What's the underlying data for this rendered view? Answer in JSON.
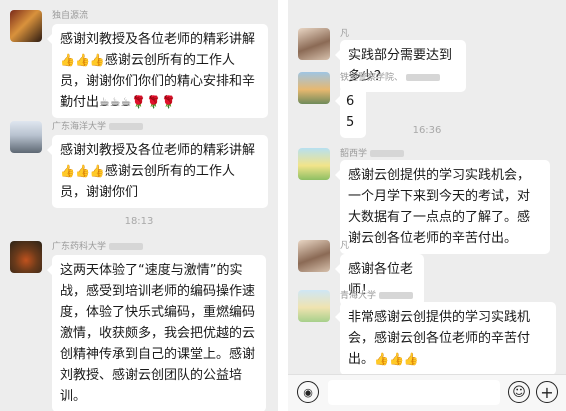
{
  "left": {
    "messages": [
      {
        "sender": "独自源流",
        "text": "感谢刘教授及各位老师的精彩讲解",
        "text2": "感谢云创所有的工作人员，谢谢你们你们的精心安排和辛勤付出"
      },
      {
        "sender": "广东海洋大学",
        "text": "感谢刘教授及各位老师的精彩讲解",
        "text2": "感谢云创所有的工作人员，谢谢你们"
      },
      {
        "sender": "广东药科大学",
        "text": "这两天体验了“速度与激情”的实战，感受到培训老师的编码操作速度，体验了快乐式编码，重燃编码激情，收获颇多，我会把优越的云创精神传承到自己的课堂上。感谢刘教授、感谢云创团队的公益培训。"
      }
    ],
    "time": "18:13"
  },
  "right": {
    "messages": [
      {
        "sender": "凡",
        "text": "实践部分需要达到多少？"
      },
      {
        "sender": "铁道警察学院、",
        "text": "65"
      },
      {
        "sender": "韶西学",
        "text": "感谢云创提供的学习实践机会，一个月学下来到今天的考试，对大数据有了一点点的了解了。感谢云创各位老师的辛苦付出。"
      },
      {
        "sender": "凡",
        "text": "感谢各位老师！"
      },
      {
        "sender": "青海大学",
        "text": "非常感谢云创提供的学习实践机会，感谢云创各位老师的辛苦付出。"
      }
    ],
    "time": "16:36"
  },
  "icons": [
    "voice-icon",
    "emoji-icon",
    "plus-icon",
    "thumbs-up-icon",
    "coffee-icon",
    "rose-icon"
  ]
}
